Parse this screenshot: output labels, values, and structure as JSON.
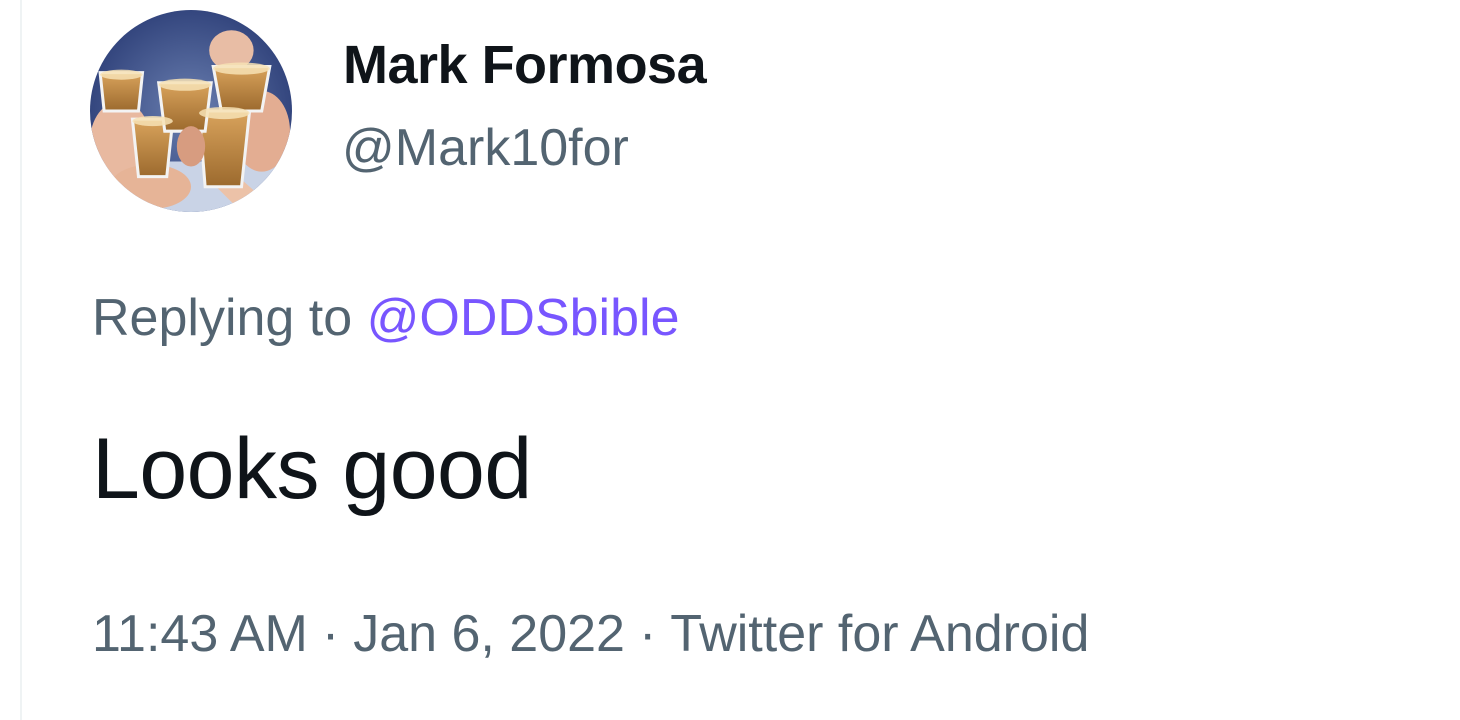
{
  "author": {
    "display_name": "Mark Formosa",
    "handle": "@Mark10for",
    "avatar_icon": "avatar-photo-drinks-toast"
  },
  "reply": {
    "prefix": "Replying to",
    "mention": "@ODDSbible"
  },
  "tweet": {
    "text": "Looks good"
  },
  "meta": {
    "time": "11:43 AM",
    "separator": "·",
    "date": "Jan 6, 2022",
    "source": "Twitter for Android"
  },
  "colors": {
    "primary_text": "#0f1419",
    "secondary_text": "#536471",
    "mention": "#7856ff",
    "divider": "#eff3f4"
  }
}
